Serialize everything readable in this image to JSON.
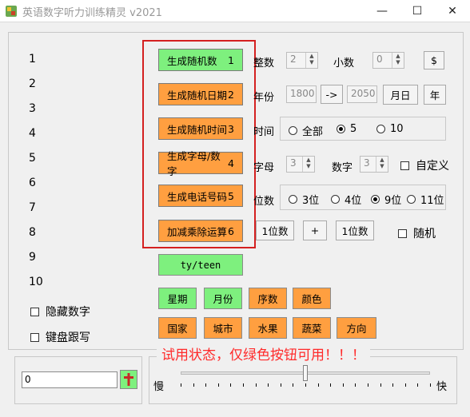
{
  "window": {
    "title": "英语数字听力训练精灵 v2021",
    "minimize": "—",
    "maximize": "☐",
    "close": "✕"
  },
  "left": {
    "numbers": [
      "1",
      "2",
      "3",
      "4",
      "5",
      "6",
      "7",
      "8",
      "9",
      "10"
    ],
    "hide_digits": "隐藏数字",
    "keyboard_dictation": "键盘跟写",
    "input_value": "0"
  },
  "gen_buttons": [
    {
      "label": "生成随机数",
      "index": "1"
    },
    {
      "label": "生成随机日期",
      "index": "2"
    },
    {
      "label": "生成随机时间",
      "index": "3"
    },
    {
      "label": "生成字母/数字",
      "index": "4"
    },
    {
      "label": "生成电话号码",
      "index": "5"
    },
    {
      "label": "加减乘除运算",
      "index": "6"
    }
  ],
  "tyteen": "ty/teen",
  "categories_row1": [
    "星期",
    "月份",
    "序数",
    "颜色"
  ],
  "categories_row2": [
    "国家",
    "城市",
    "水果",
    "蔬菜",
    "方向"
  ],
  "settings": {
    "integer_label": "整数",
    "integer_value": "2",
    "decimal_label": "小数",
    "decimal_value": "0",
    "dollar": "$",
    "year_label": "年份",
    "year_from": "1800",
    "arrow": "->",
    "year_to": "2050",
    "month_day": "月日",
    "year_btn": "年",
    "time_label": "时间",
    "time_options": [
      "全部",
      "5",
      "10"
    ],
    "time_selected": "5",
    "letters_label": "字母",
    "letters_value": "3",
    "digits_label": "数字",
    "digits_value": "3",
    "custom": "自定义",
    "places_label": "位数",
    "place_options": [
      "3位",
      "4位",
      "9位",
      "11位"
    ],
    "place_selected": "9位",
    "op_left": "1位数",
    "op_sign": "+",
    "op_right": "1位数",
    "random": "随机"
  },
  "trial_notice": "试用状态，仅绿色按钮可用！！！",
  "speed": {
    "slow": "慢",
    "fast": "快",
    "level": 0.5
  },
  "colors": {
    "green": "#7ef07e",
    "orange": "#ff9f40",
    "highlight": "#d42020",
    "notice": "#ff2a2a"
  }
}
